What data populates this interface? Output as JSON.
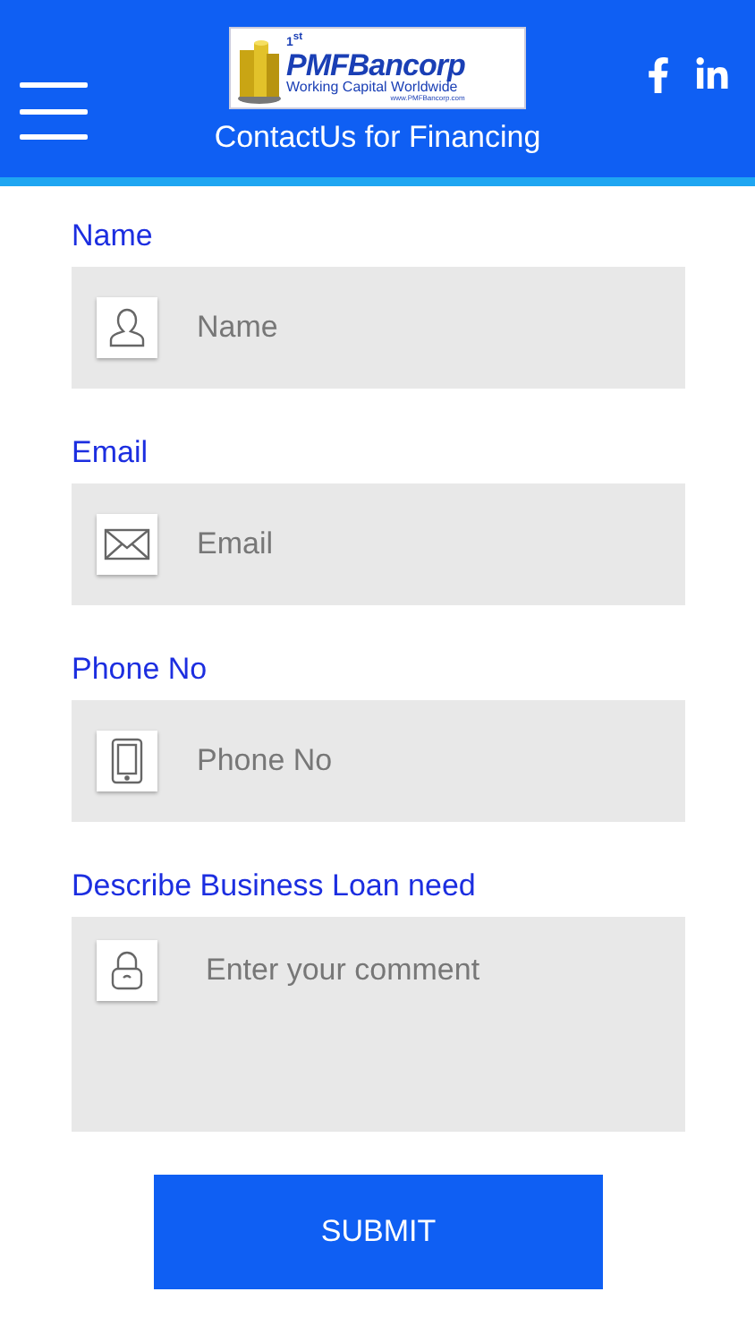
{
  "header": {
    "logo": {
      "superscript": "1$^{st}$",
      "brand": "PMFBancorp",
      "tagline": "Working Capital Worldwide",
      "url": "www.PMFBancorp.com"
    },
    "title": "ContactUs for Financing"
  },
  "fields": [
    {
      "kind": "input",
      "label": "Name",
      "placeholder": "Name"
    },
    {
      "kind": "input",
      "label": "Email",
      "placeholder": "Email"
    },
    {
      "kind": "input",
      "label": "Phone No",
      "placeholder": "Phone No"
    },
    {
      "kind": "textarea",
      "label": "Describe Business Loan need",
      "placeholder": "Enter your comment"
    }
  ],
  "submit": "SUBMIT"
}
